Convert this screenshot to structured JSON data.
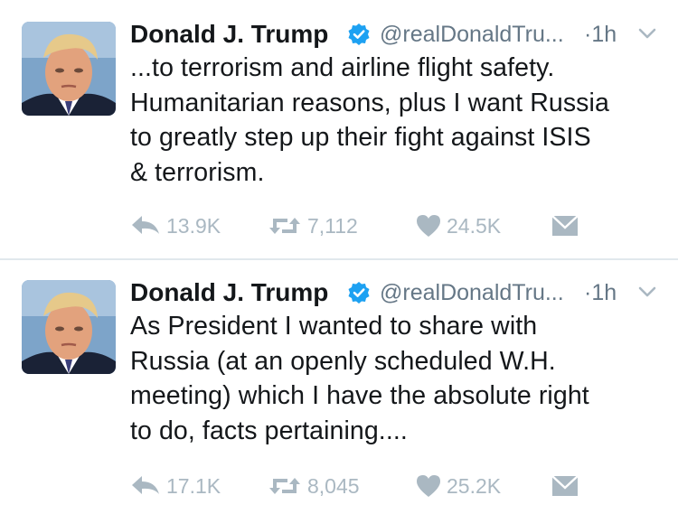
{
  "tweets": [
    {
      "author": {
        "name": "Donald J. Trump",
        "handle": "@realDonaldTru...",
        "verified": true
      },
      "time": "·1h",
      "lines": [
        "...to terrorism and airline flight safety.",
        "Humanitarian reasons, plus I want Russia",
        "to greatly step up their fight against ISIS",
        "& terrorism."
      ],
      "stats": {
        "replies": "13.9K",
        "retweets": "7,112",
        "likes": "24.5K"
      }
    },
    {
      "author": {
        "name": "Donald J. Trump",
        "handle": "@realDonaldTru...",
        "verified": true
      },
      "time": "·1h",
      "lines": [
        "As President I wanted to share with",
        "Russia (at an openly scheduled W.H.",
        "meeting) which I have the absolute right",
        "to do, facts pertaining...."
      ],
      "stats": {
        "replies": "17.1K",
        "retweets": "8,045",
        "likes": "25.2K"
      }
    }
  ],
  "colors": {
    "verified_badge": "#1da1f2",
    "action_gray": "#aab8c2",
    "divider": "#e1e8ed"
  },
  "icons": [
    "verified-badge-icon",
    "chevron-down-icon",
    "reply-icon",
    "retweet-icon",
    "heart-icon",
    "envelope-icon"
  ]
}
